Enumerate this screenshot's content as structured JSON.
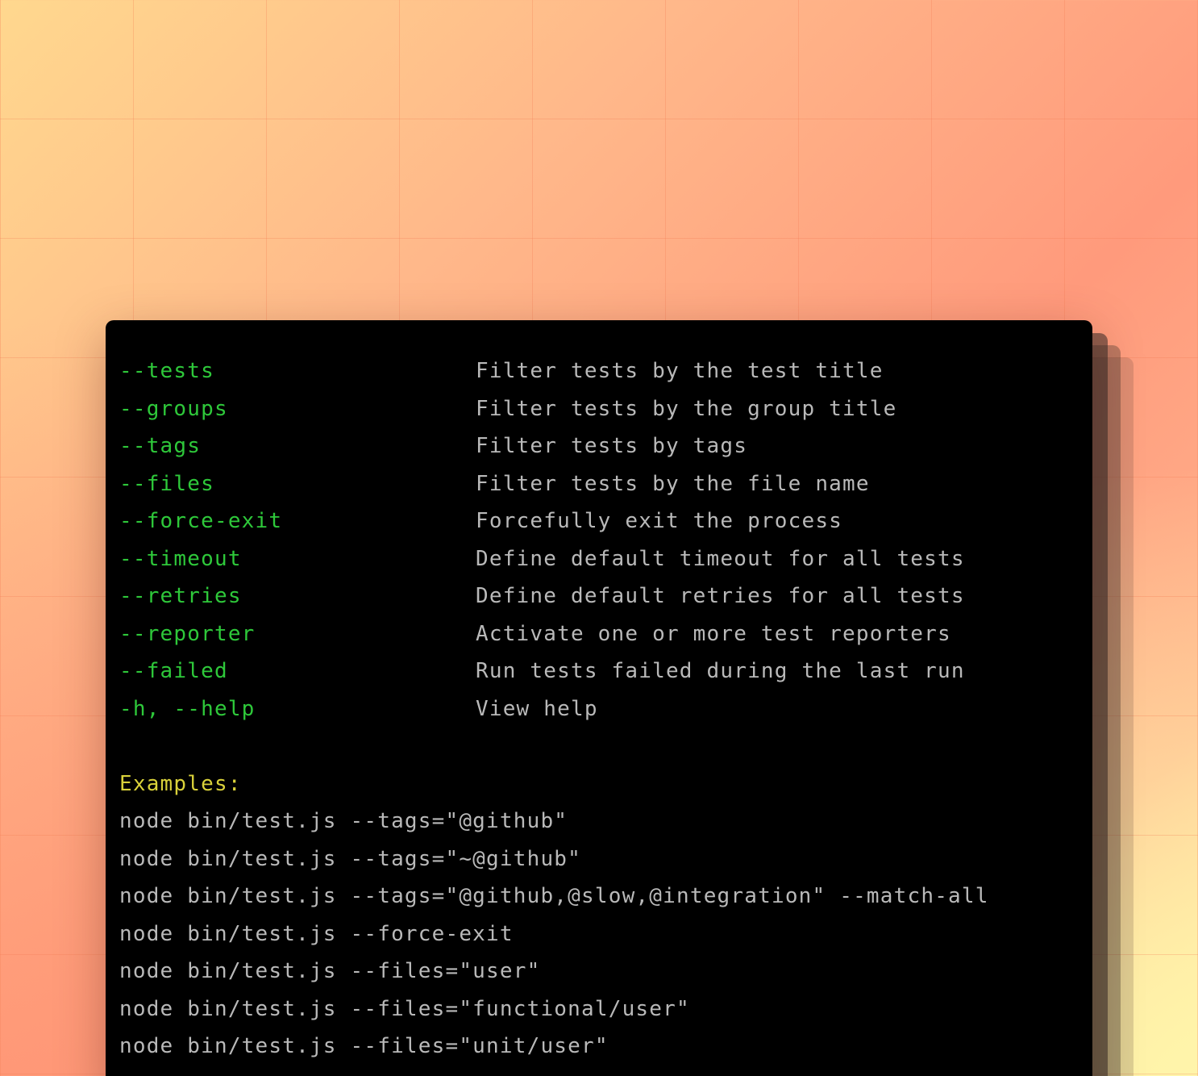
{
  "options": [
    {
      "flag": "--tests",
      "description": "Filter tests by the test title"
    },
    {
      "flag": "--groups",
      "description": "Filter tests by the group title"
    },
    {
      "flag": "--tags",
      "description": "Filter tests by tags"
    },
    {
      "flag": "--files",
      "description": "Filter tests by the file name"
    },
    {
      "flag": "--force-exit",
      "description": "Forcefully exit the process"
    },
    {
      "flag": "--timeout",
      "description": "Define default timeout for all tests"
    },
    {
      "flag": "--retries",
      "description": "Define default retries for all tests"
    },
    {
      "flag": "--reporter",
      "description": "Activate one or more test reporters"
    },
    {
      "flag": "--failed",
      "description": "Run tests failed during the last run"
    },
    {
      "flag": "-h, --help",
      "description": "View help"
    }
  ],
  "examples_title": "Examples:",
  "examples": [
    "node bin/test.js --tags=\"@github\"",
    "node bin/test.js --tags=\"~@github\"",
    "node bin/test.js --tags=\"@github,@slow,@integration\" --match-all",
    "node bin/test.js --force-exit",
    "node bin/test.js --files=\"user\"",
    "node bin/test.js --files=\"functional/user\"",
    "node bin/test.js --files=\"unit/user\""
  ],
  "colors": {
    "flag": "#2ec83a",
    "description": "#b9b9b9",
    "examples_title": "#d9d13a",
    "terminal_background": "#000000"
  }
}
